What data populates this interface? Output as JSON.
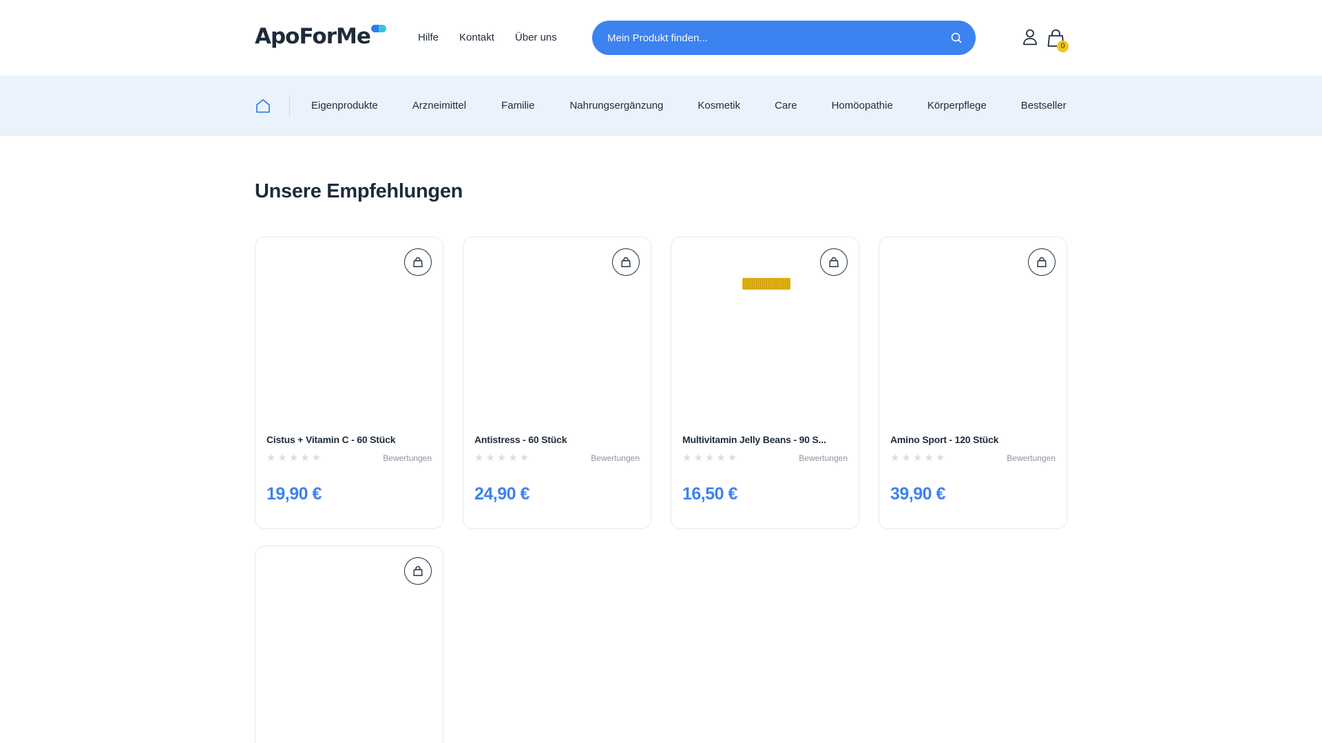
{
  "header": {
    "logo_text": "ApoForMe",
    "nav": [
      {
        "label": "Hilfe"
      },
      {
        "label": "Kontakt"
      },
      {
        "label": "Über uns"
      }
    ],
    "search": {
      "placeholder": "Mein Produkt finden..."
    },
    "cart_count": "0"
  },
  "categories": [
    {
      "label": "Eigenprodukte"
    },
    {
      "label": "Arzneimittel"
    },
    {
      "label": "Familie"
    },
    {
      "label": "Nahrungsergänzung"
    },
    {
      "label": "Kosmetik"
    },
    {
      "label": "Care"
    },
    {
      "label": "Homöopathie"
    },
    {
      "label": "Körperpflege"
    },
    {
      "label": "Bestseller"
    }
  ],
  "section": {
    "title": "Unsere Empfehlungen"
  },
  "products": [
    {
      "name": "Cistus + Vitamin C - 60 Stück",
      "rating": 0,
      "reviews_label": "Bewertungen",
      "price": "19,90 €"
    },
    {
      "name": "Antistress - 60 Stück",
      "rating": 0,
      "reviews_label": "Bewertungen",
      "price": "24,90 €"
    },
    {
      "name": "Multivitamin Jelly Beans - 90 S...",
      "rating": 0,
      "reviews_label": "Bewertungen",
      "price": "16,50 €"
    },
    {
      "name": "Amino Sport - 120 Stück",
      "rating": 0,
      "reviews_label": "Bewertungen",
      "price": "39,90 €"
    },
    {
      "name": "",
      "rating": 0,
      "reviews_label": "",
      "price": ""
    }
  ],
  "colors": {
    "accent": "#3c82f0",
    "category_bar": "#eaf2fc",
    "badge": "#f5c518",
    "text": "#1f2b3a"
  },
  "icons": [
    "home-icon",
    "search-icon",
    "user-icon",
    "cart-icon",
    "shopping-bag-icon",
    "star-icon"
  ]
}
